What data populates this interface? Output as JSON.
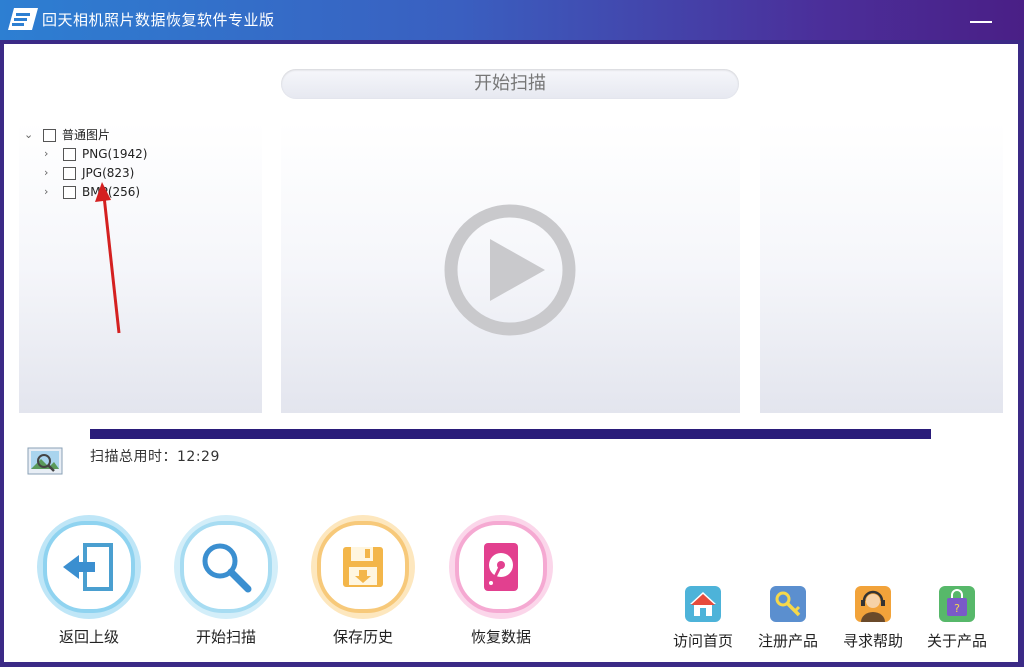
{
  "window": {
    "title": "回天相机照片数据恢复软件专业版"
  },
  "scan_header": {
    "label": "开始扫描"
  },
  "tree": {
    "root": {
      "label": "普通图片"
    },
    "children": [
      {
        "label": "PNG(1942)"
      },
      {
        "label": "JPG(823)"
      },
      {
        "label": "BMP(256)"
      }
    ]
  },
  "progress": {
    "value": 1.0
  },
  "scan_time": {
    "text": "扫描总用时：12:29"
  },
  "actions": [
    {
      "label": "返回上级",
      "icon": "back-door-icon",
      "color": "#8fd3f0"
    },
    {
      "label": "开始扫描",
      "icon": "magnifier-icon",
      "color": "#a7dcf2"
    },
    {
      "label": "保存历史",
      "icon": "floppy-disk-icon",
      "color": "#f7c97a"
    },
    {
      "label": "恢复数据",
      "icon": "hard-disk-icon",
      "color": "#f5a9d2"
    }
  ],
  "links": [
    {
      "label": "访问首页",
      "icon": "home-icon"
    },
    {
      "label": "注册产品",
      "icon": "key-icon"
    },
    {
      "label": "寻求帮助",
      "icon": "support-agent-icon"
    },
    {
      "label": "关于产品",
      "icon": "shopping-bag-icon"
    }
  ]
}
